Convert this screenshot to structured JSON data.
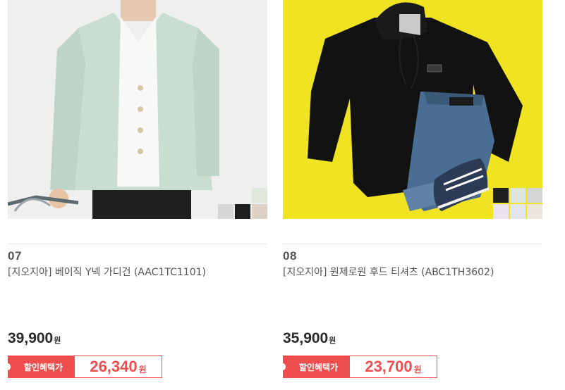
{
  "products": [
    {
      "number": "07",
      "name": "[지오지아] 베이직 Y넥 가디건 (AAC1TC1101)",
      "price": "39,900",
      "price_unit": "원",
      "sale_label": "할인혜택가",
      "sale_price": "26,340",
      "sale_unit": "원",
      "image": "mint-v-neck-cardigan-photo",
      "color_swatches": [
        "#dfe6dc",
        "#d6d6d6",
        "#1e1e1e",
        "#ddd0c4"
      ]
    },
    {
      "number": "08",
      "name": "[지오지아] 원제로원 후드 티셔츠 (ABC1TH3602)",
      "price": "35,900",
      "price_unit": "원",
      "sale_label": "할인혜택가",
      "sale_price": "23,700",
      "sale_unit": "원",
      "image": "black-hoodie-flatlay-photo",
      "color_swatches": [
        "#1e1e1e",
        "#dde6dd",
        "#d5d5d7",
        "#e9e4ee",
        "#e4e6ee",
        "#ede6dc"
      ]
    }
  ],
  "colors": {
    "accent": "#f04e4e",
    "hoodie_background": "#f0e321"
  }
}
